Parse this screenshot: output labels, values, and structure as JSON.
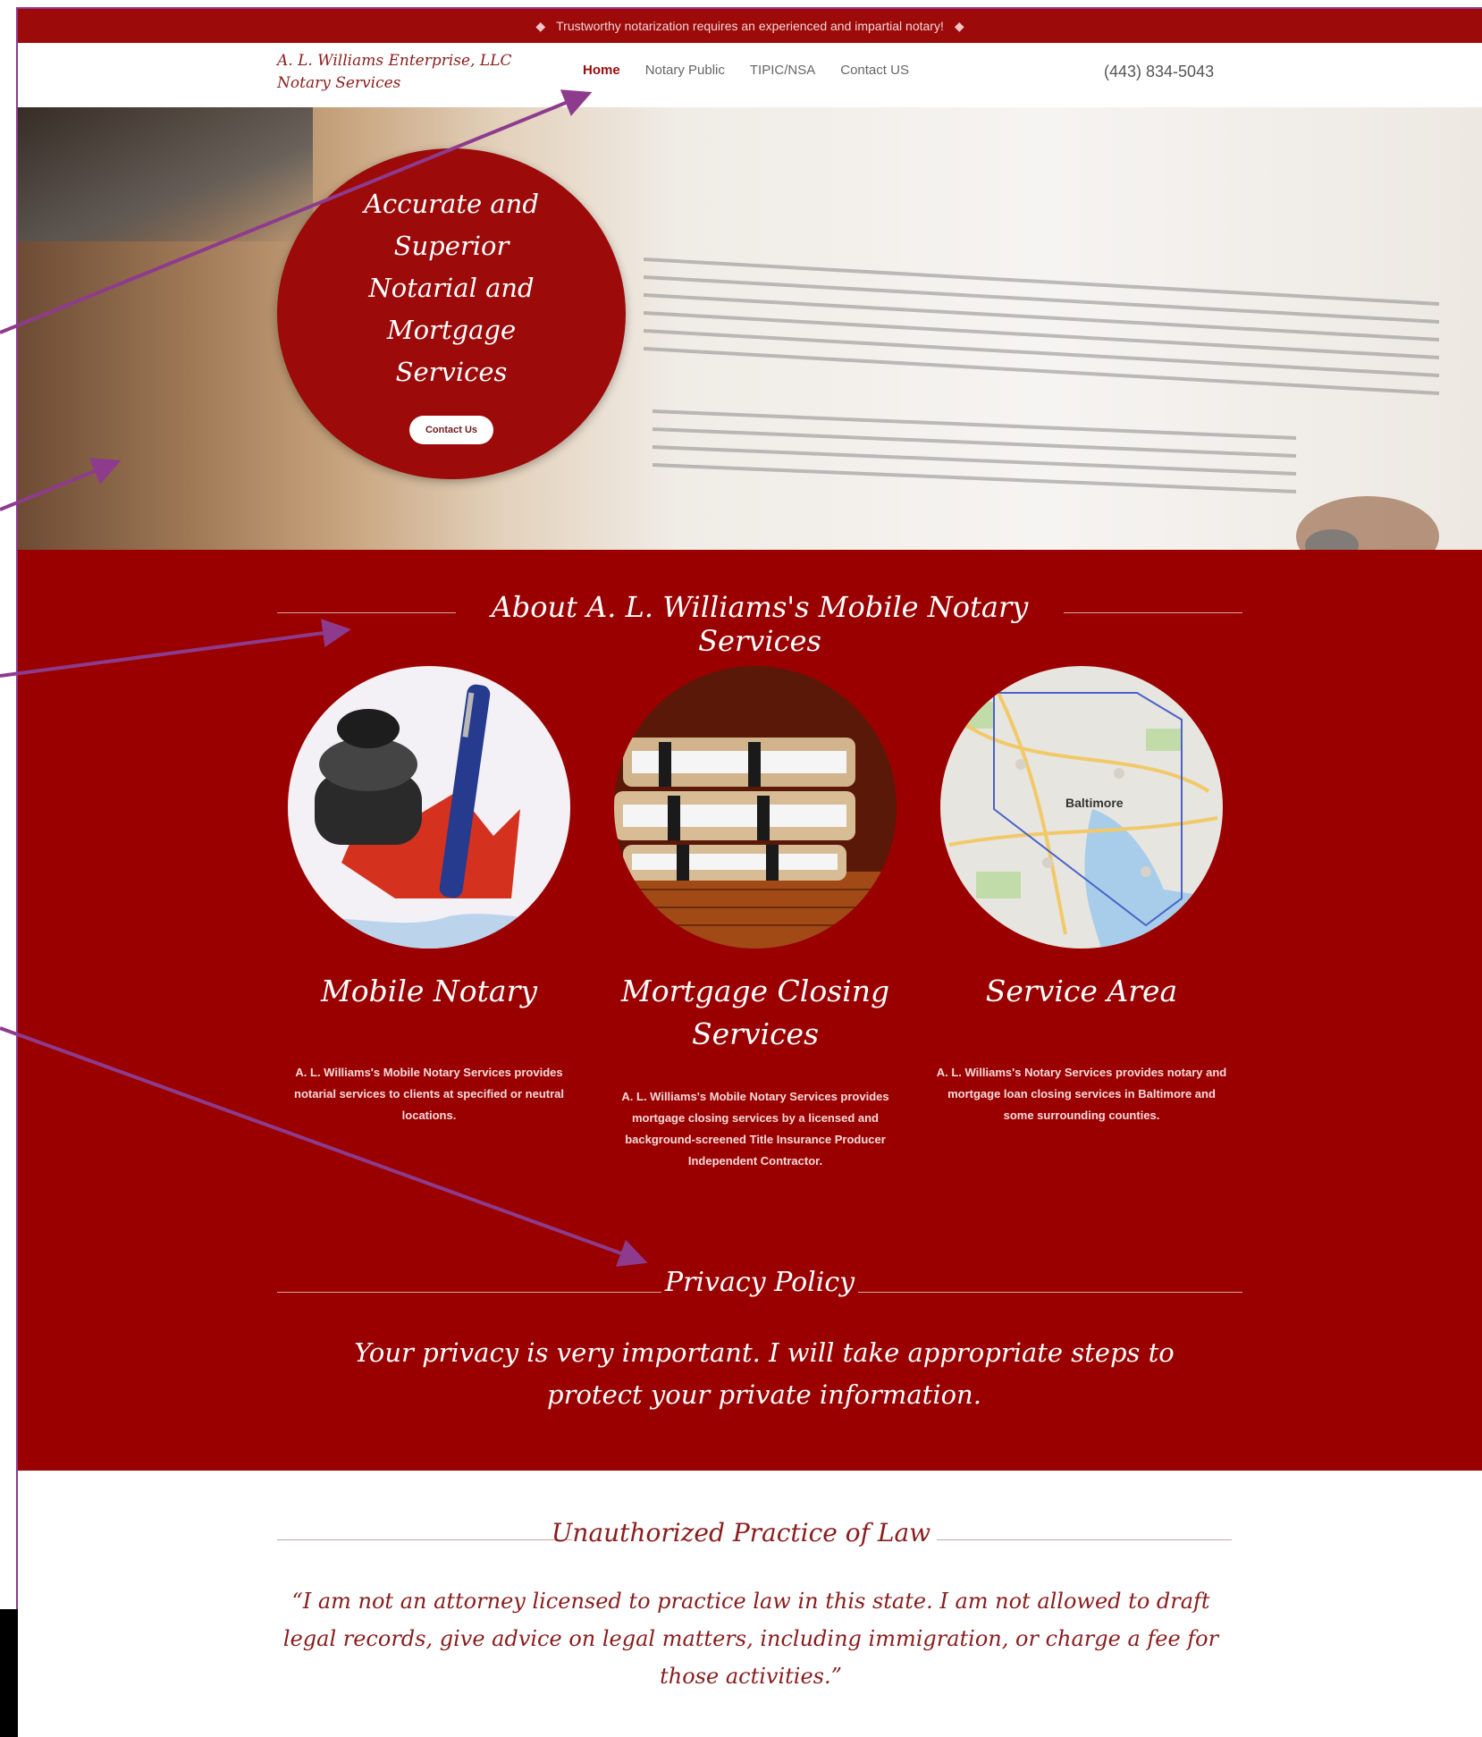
{
  "topbar": {
    "text": "Trustworthy notarization requires an experienced and impartial notary!"
  },
  "header": {
    "logo_line1": "A. L. Williams Enterprise, LLC",
    "logo_line2": "Notary Services",
    "nav": [
      {
        "label": "Home",
        "active": true
      },
      {
        "label": "Notary Public",
        "active": false
      },
      {
        "label": "TIPIC/NSA",
        "active": false
      },
      {
        "label": "Contact US",
        "active": false
      }
    ],
    "phone": "(443) 834-5043"
  },
  "hero": {
    "title_line1": "Accurate and Superior",
    "title_line2": "Notarial and Mortgage",
    "title_line3": "Services",
    "button_label": "Contact Us"
  },
  "about": {
    "title": "About A. L. Williams's Mobile Notary Services",
    "cards": [
      {
        "title": "Mobile Notary",
        "text": "A. L. Williams's Mobile Notary Services provides notarial services to clients at specified or neutral locations."
      },
      {
        "title": "Mortgage Closing Services",
        "text": "A. L. Williams's Mobile Notary Services provides mortgage closing services by a licensed and background-screened Title Insurance Producer Independent Contractor."
      },
      {
        "title": "Service Area",
        "text": "A. L. Williams's Notary Services provides notary and mortgage loan closing services in Baltimore and some surrounding counties.",
        "map_label": "Baltimore"
      }
    ]
  },
  "privacy": {
    "title": "Privacy Policy",
    "text": "Your privacy is very important. I will take appropriate steps to protect your private information."
  },
  "law": {
    "title": "Unauthorized Practice of Law",
    "quote": "“I am not an attorney licensed to practice law in this state. I am not allowed to draft legal records, give advice on legal matters, including immigration, or charge a fee for those activities.”"
  },
  "colors": {
    "brand_red": "#9b0000",
    "annotation_purple": "#8e3b8e",
    "accent_text": "#8a1c1c"
  }
}
